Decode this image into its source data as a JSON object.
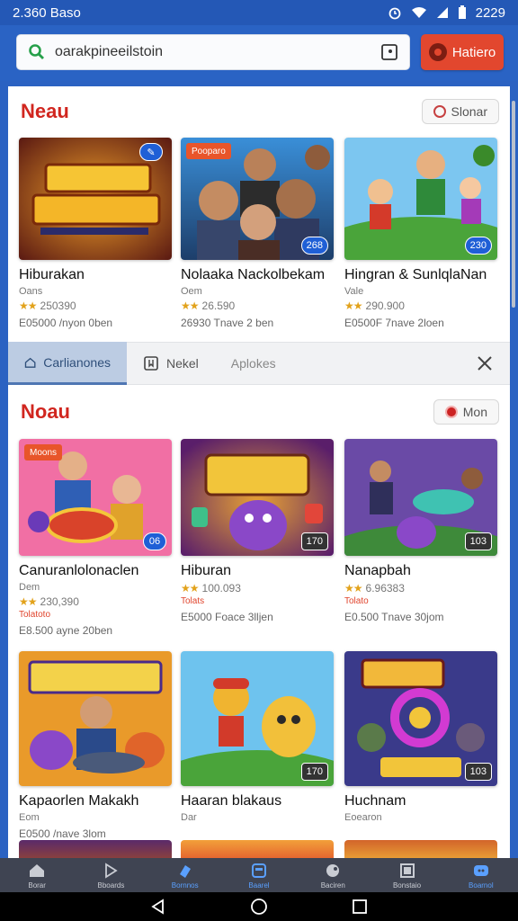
{
  "status": {
    "time": "2.360 Baso",
    "clock": "2229",
    "alarm_icon": "alarm-icon",
    "wifi_icon": "wifi-icon",
    "signal_icon": "signal-icon",
    "battery_icon": "battery-icon"
  },
  "header": {
    "search_value": "oarakpineeilstoin",
    "button_label": "Hatiero"
  },
  "section1": {
    "title": "Neau",
    "more_label": "Slonar",
    "cards": [
      {
        "title": "Hiburakan",
        "sub": "Oans",
        "rating": "250390",
        "meta": "E05000 /nyon 0ben",
        "badge": "",
        "tag": ""
      },
      {
        "title": "Nolaaka Nackolbekam",
        "sub": "Oem",
        "rating": "26.590",
        "meta": "26930 Tnave 2 ben",
        "badge": "268",
        "tag": "Pooparo"
      },
      {
        "title": "Hingran & SunlqlaNan",
        "sub": "Vale",
        "rating": "290.900",
        "meta": "E0500F 7nave 2loen",
        "badge": "230",
        "tag": ""
      }
    ]
  },
  "tabs": {
    "items": [
      {
        "label": "Carlianones"
      },
      {
        "label": "Nekel"
      },
      {
        "label": "Aplokes"
      }
    ]
  },
  "section2": {
    "title": "Noau",
    "more_label": "Mon",
    "cards": [
      {
        "title": "Canuranlolonaclen",
        "sub": "Dem",
        "rating": "230,390",
        "promo": "Tolatoto",
        "meta": "E8.500 ayne 20ben",
        "badge": "06",
        "tag": "Moons"
      },
      {
        "title": "Hiburan",
        "sub": "",
        "rating": "100.093",
        "promo": "Tolats",
        "meta": "E5000 Foace 3lljen",
        "badge": "170",
        "tag": ""
      },
      {
        "title": "Nanapbah",
        "sub": "",
        "rating": "6.96383",
        "promo": "Tolato",
        "meta": "E0.500 Tnave 30jom",
        "badge": "103",
        "tag": ""
      },
      {
        "title": "Kapaorlen Makakh",
        "sub": "Eom",
        "rating": "",
        "promo": "",
        "meta": "E0500 /nave 3lom",
        "badge": "",
        "tag": ""
      },
      {
        "title": "Haaran blakaus",
        "sub": "Dar",
        "rating": "",
        "promo": "",
        "meta": "",
        "badge": "170",
        "tag": ""
      },
      {
        "title": "Huchnam",
        "sub": "Eoearon",
        "rating": "",
        "promo": "",
        "meta": "",
        "badge": "103",
        "tag": ""
      }
    ]
  },
  "bottom_nav": {
    "items": [
      {
        "label": "Borar",
        "icon": "home-icon"
      },
      {
        "label": "Bboards",
        "icon": "play-icon"
      },
      {
        "label": "Bornnos",
        "icon": "bolt-icon"
      },
      {
        "label": "Baarel",
        "icon": "tablet-icon"
      },
      {
        "label": "Baciren",
        "icon": "puzzle-icon"
      },
      {
        "label": "Bonstaio",
        "icon": "window-icon"
      },
      {
        "label": "Boarnol",
        "icon": "chat-icon"
      }
    ]
  },
  "colors": {
    "accent": "#2a63c4",
    "primary_button": "#e2472e",
    "section_title": "#d1261f"
  }
}
